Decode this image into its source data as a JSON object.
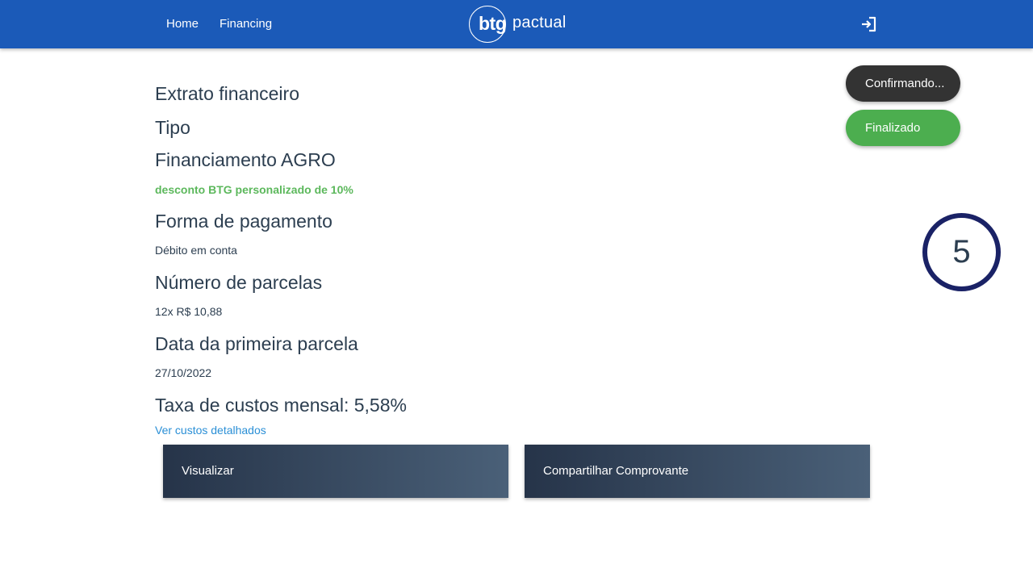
{
  "nav": {
    "home": "Home",
    "financing": "Financing",
    "logo_btg": "btg",
    "logo_pactual": "pactual",
    "logout_icon": "logout-icon"
  },
  "statement": {
    "title": "Extrato financeiro",
    "type_label": "Tipo",
    "type_value": "Financiamento AGRO",
    "discount": "desconto BTG personalizado de 10%",
    "payment_label": "Forma de pagamento",
    "payment_value": "Débito em conta",
    "installments_label": "Número de parcelas",
    "installments_value": "12x R$ 10,88",
    "first_date_label": "Data da primeira parcela",
    "first_date_value": "27/10/2022",
    "monthly_rate": "Taxa de custos mensal: 5,58%",
    "details_link": "Ver custos detalhados"
  },
  "actions": {
    "view": "Visualizar",
    "share": "Compartilhar Comprovante"
  },
  "status": {
    "confirming": "Confirmando...",
    "finished": "Finalizado",
    "step_number": "5"
  },
  "colors": {
    "header": "#1b5ab8",
    "promo": "#5cb85c",
    "link": "#2a8fd6",
    "confirm_pill": "#333333",
    "finished_pill": "#4cae4f",
    "step_ring": "#1a2266"
  }
}
